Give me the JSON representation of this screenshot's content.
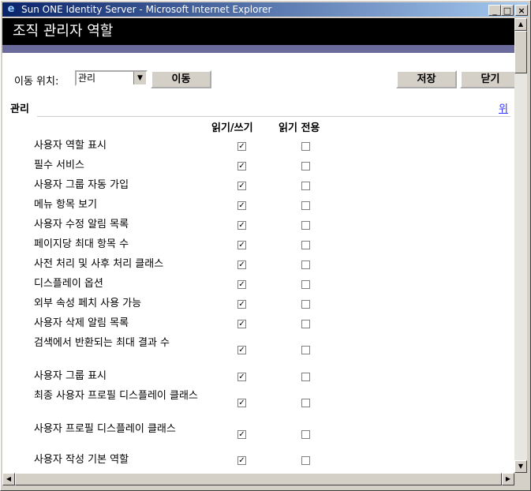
{
  "window": {
    "title": "Sun ONE Identity Server - Microsoft Internet Explorer",
    "ie_glyph": "e"
  },
  "page": {
    "heading": "조직 관리자 역할"
  },
  "toolbar": {
    "nav_label": "이동 위치:",
    "nav_select_value": "관리",
    "go_label": "이동",
    "save_label": "저장",
    "close_label": "닫기"
  },
  "section": {
    "title": "관리",
    "top_link": "위"
  },
  "columns": {
    "read_write": "읽기/쓰기",
    "read_only": "읽기 전용"
  },
  "rows": [
    {
      "label": "사용자 역할 표시",
      "read_write": true,
      "read_only": false
    },
    {
      "label": "필수 서비스",
      "read_write": true,
      "read_only": false
    },
    {
      "label": "사용자 그룹 자동 가입",
      "read_write": true,
      "read_only": false
    },
    {
      "label": "메뉴 항목 보기",
      "read_write": true,
      "read_only": false
    },
    {
      "label": "사용자 수정 알림 목록",
      "read_write": true,
      "read_only": false
    },
    {
      "label": "페이지당 최대 항목 수",
      "read_write": true,
      "read_only": false
    },
    {
      "label": "사전 처리 및 사후 처리 클래스",
      "read_write": true,
      "read_only": false
    },
    {
      "label": "디스플레이 옵션",
      "read_write": true,
      "read_only": false
    },
    {
      "label": "외부 속성 페치 사용 가능",
      "read_write": true,
      "read_only": false
    },
    {
      "label": "사용자 삭제 알림 목록",
      "read_write": true,
      "read_only": false
    },
    {
      "label": "검색에서 반환되는 최대 결과 수",
      "read_write": true,
      "read_only": false
    },
    {
      "label": "사용자 그룹 표시",
      "read_write": true,
      "read_only": false
    },
    {
      "label": "최종 사용자 프로필 디스플레이 클래스",
      "read_write": true,
      "read_only": false
    },
    {
      "label": "사용자 프로필 디스플레이 클래스",
      "read_write": true,
      "read_only": false
    },
    {
      "label": "사용자 작성 기본 역할",
      "read_write": true,
      "read_only": false
    }
  ]
}
